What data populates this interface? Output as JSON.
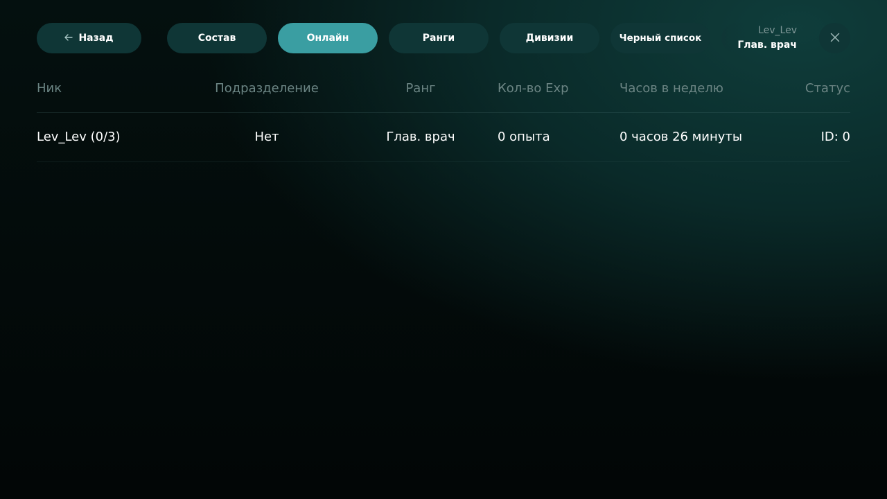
{
  "nav": {
    "back_label": "Назад",
    "tabs": [
      {
        "label": "Состав",
        "active": false
      },
      {
        "label": "Онлайн",
        "active": true
      },
      {
        "label": "Ранги",
        "active": false
      },
      {
        "label": "Дивизии",
        "active": false
      },
      {
        "label": "Черный список",
        "active": false
      }
    ]
  },
  "user": {
    "name": "Lev_Lev",
    "rank": "Глав. врач"
  },
  "table": {
    "columns": [
      "Ник",
      "Подразделение",
      "Ранг",
      "Кол-во Exp",
      "Часов в неделю",
      "Статус"
    ],
    "rows": [
      [
        "Lev_Lev (0/3)",
        "Нет",
        "Глав. врач",
        "0 опыта",
        "0 часов 26 минуты",
        "ID: 0"
      ]
    ]
  },
  "colors": {
    "accent": "#3a9ea2",
    "pill_bg": "#0f3636",
    "header_text": "#6c8584"
  },
  "icons": {
    "back": "arrow-left-icon",
    "close": "close-icon"
  }
}
